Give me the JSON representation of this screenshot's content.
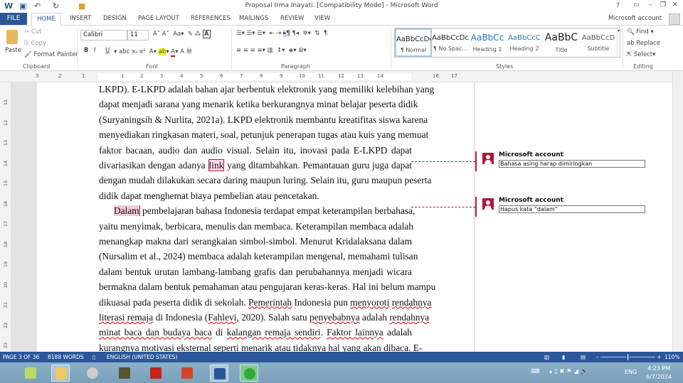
{
  "window": {
    "title": "Proposal Irma Inayati. [Compatibility Mode] - Microsoft Word",
    "help": "?",
    "account": "Microsoft account"
  },
  "tabs": [
    "FILE",
    "HOME",
    "INSERT",
    "DESIGN",
    "PAGE LAYOUT",
    "REFERENCES",
    "MAILINGS",
    "REVIEW",
    "VIEW"
  ],
  "clipboard": {
    "paste": "Paste",
    "cut": "Cut",
    "copy": "Copy",
    "format_painter": "Format Painter",
    "label": "Clipboard"
  },
  "font": {
    "name": "Calibri",
    "size": "11",
    "label": "Font",
    "bold": "B",
    "italic": "I",
    "underline": "U"
  },
  "paragraph": {
    "label": "Paragraph"
  },
  "styles": {
    "label": "Styles",
    "items": [
      {
        "preview": "AaBbCcDc",
        "name": "¶ Normal"
      },
      {
        "preview": "AaBbCcDc",
        "name": "¶ No Spac..."
      },
      {
        "preview": "AaBbCc",
        "name": "Heading 1"
      },
      {
        "preview": "AaBbCcC",
        "name": "Heading 2"
      },
      {
        "preview": "AaBbC",
        "name": "Title"
      },
      {
        "preview": "AaBbCcD",
        "name": "Subtitle"
      }
    ]
  },
  "editing": {
    "label": "Editing",
    "find": "Find",
    "replace": "Replace",
    "select": "Select"
  },
  "ruler": {
    "h": [
      "3",
      "2",
      "1",
      "1",
      "2",
      "3",
      "4",
      "5",
      "6",
      "7",
      "8",
      "9",
      "10",
      "11",
      "12",
      "13",
      "14",
      "16",
      "17"
    ],
    "v": [
      "11",
      "12",
      "13",
      "14",
      "15",
      "16",
      "17",
      "18",
      "19",
      "20",
      "21",
      "22",
      "23"
    ]
  },
  "document": {
    "lines": [
      "LKPD). E-LKPD adalah bahan ajar berbentuk elektronik yang memiliki kelebihan yang",
      "dapat menjadi sarana yang menarik ketika berkurangnya minat belajar peserta didik",
      "(Suryaningsih & Nurlita, 2021a). LKPD elektronik membantu kreatifitas siswa karena",
      "menyediakan ringkasan materi, soal, petunjuk penerapan tugas atau kuis yang memuat",
      "faktor bacaan, audio dan audio visual. Selain itu, inovasi pada E-LKPD dapat",
      "divariasikan dengan adanya link yang ditambahkan. Pemantauan guru juga dapat",
      "dengan mudah dilakukan secara daring maupun luring. Selain itu, guru maupun peserta",
      "didik dapat menghemat biaya pembelian atau pencetakan.",
      "Dalam pembelajaran bahasa Indonesia terdapat empat keterampilan berbahasa,",
      "yaitu menyimak, berbicara, menulis dan membaca. Keterampilan membaca adalah",
      "menangkap makna dari serangkaian simbol-simbol. Menurut Kridalaksana dalam",
      "(Nursalim et al., 2024) membaca adalah keterampilan mengenal, memahami tulisan",
      "dalam bentuk urutan lambang-lambang grafis dan perubahannya menjadi wicara",
      "bermakna dalam bentuk pemahaman atau pengujaran keras-keras. Hal ini belum mampu",
      "dikuasai pada peserta didik di sekolah. Pemerintah Indonesia pun menyoroti rendahnya",
      "literasi remaja di Indonesia (Fahlevi, 2020). Salah satu penyebabnya adalah rendahnya",
      "minat baca dan budaya baca di kalangan remaja sendiri. Faktor lainnya adalah",
      "kurangnya motivasi eksternal seperti menarik atau tidaknya hal yang akan dibaca. E-"
    ]
  },
  "comments": [
    {
      "author": "Microsoft account",
      "text": "Bahasa asing harap dimiringkan"
    },
    {
      "author": "Microsoft account",
      "text": "Hapus kata “dalam”"
    }
  ],
  "status": {
    "page": "PAGE 3 OF 36",
    "words": "8188 WORDS",
    "language": "ENGLISH (UNITED STATES)",
    "zoom": "110%"
  },
  "taskbar": {
    "time": "4:23 PM",
    "date": "6/7/2024",
    "lang": "ENG"
  },
  "colors": {
    "accent": "#2b579a",
    "comment": "#b0163e"
  }
}
